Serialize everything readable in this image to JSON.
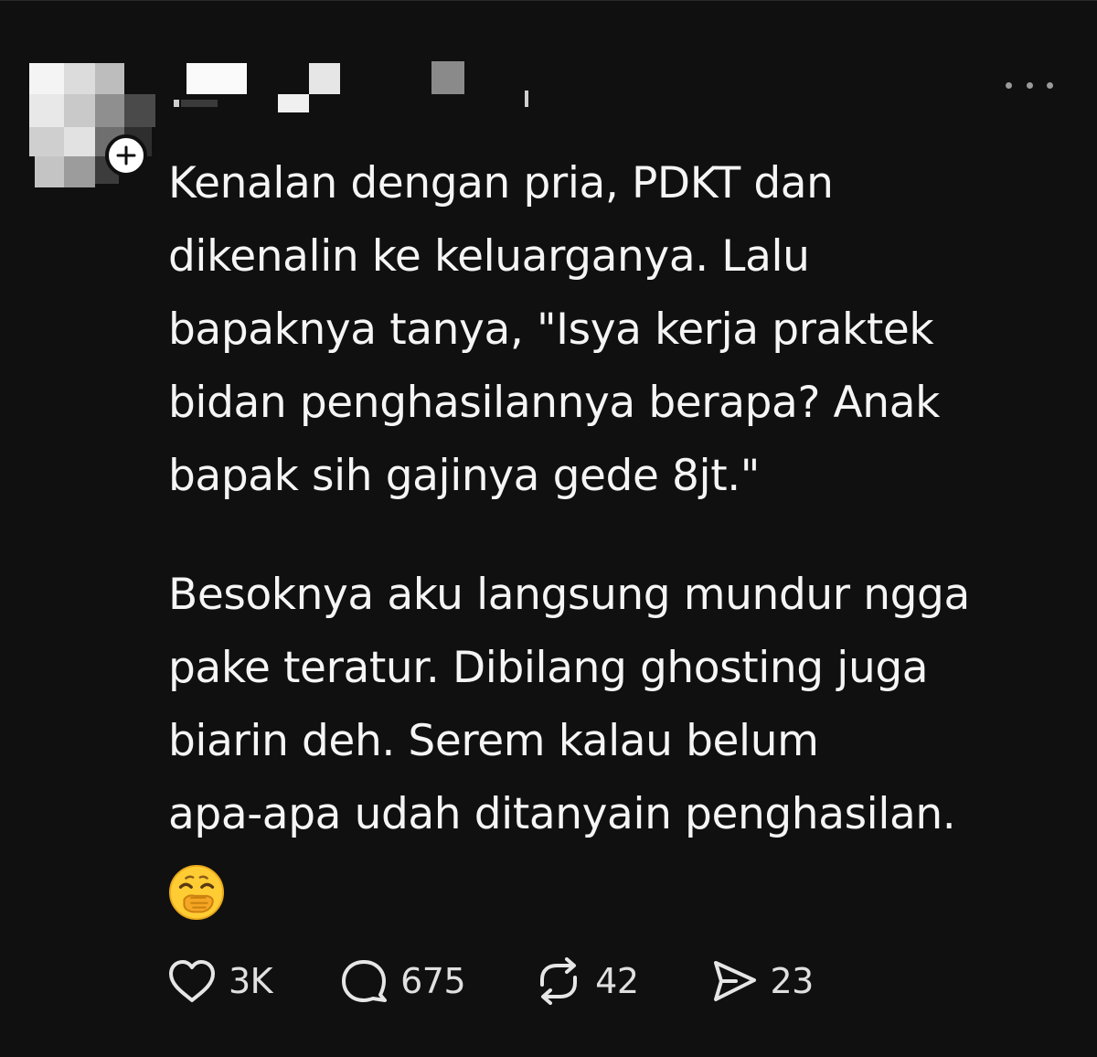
{
  "post": {
    "paragraphs": [
      "Kenalan dengan pria, PDKT dan\ndikenalin ke keluarganya. Lalu\nbapaknya tanya, \"Isya kerja praktek\nbidan penghasilannya berapa? Anak\nbapak sih gajinya gede 8jt.\"",
      "Besoknya aku langsung mundur ngga\npake teratur. Dibilang ghosting juga\nbiarin deh. Serem kalau belum\napa-apa udah ditanyain penghasilan."
    ],
    "emoji": "face-with-hand-over-mouth-icon"
  },
  "actions": {
    "likes": "3K",
    "replies": "675",
    "reposts": "42",
    "shares": "23"
  },
  "icons": {
    "like": "heart-icon",
    "reply": "speech-bubble-icon",
    "repost": "repost-arrows-icon",
    "share": "send-icon",
    "follow": "plus-icon",
    "more": "more-dots-icon"
  },
  "colors": {
    "background": "#101010",
    "text": "#f5f5f5",
    "icon": "#e0e0e0",
    "muted": "#9a9a9a"
  }
}
